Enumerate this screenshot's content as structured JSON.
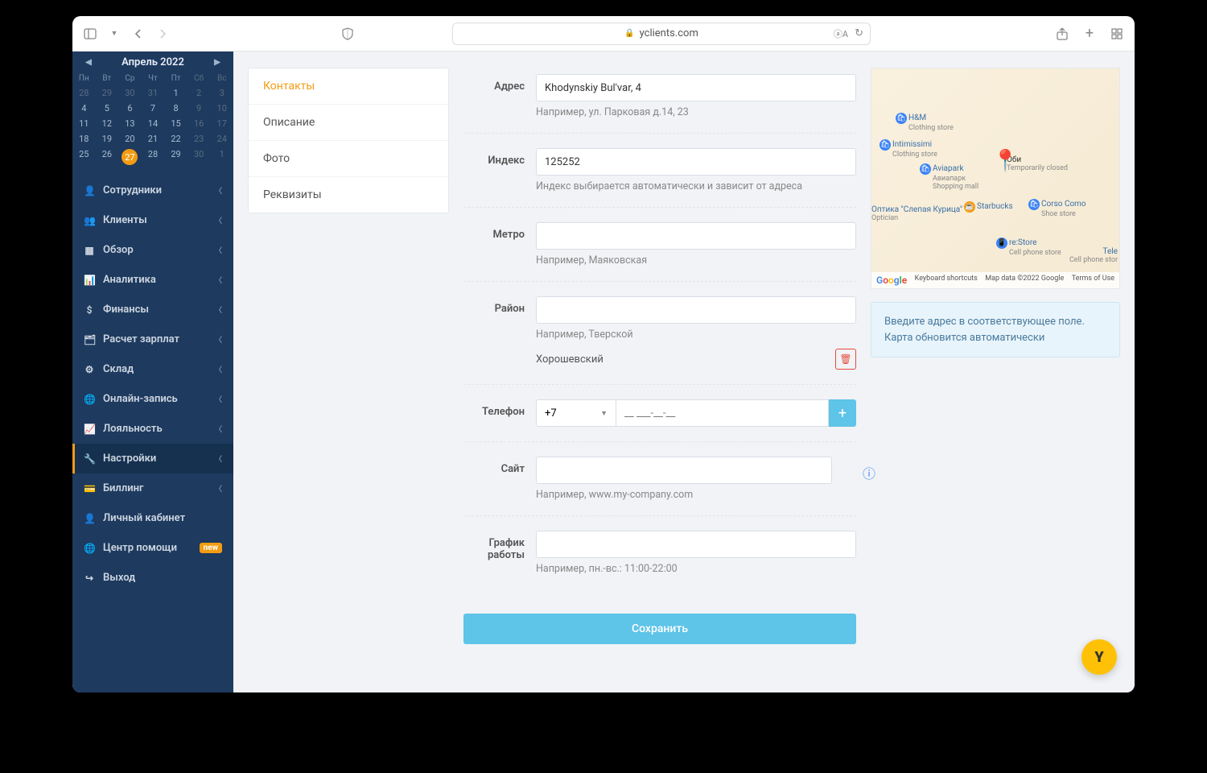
{
  "browser": {
    "url": "yclients.com"
  },
  "calendar": {
    "title": "Апрель 2022",
    "dow": [
      "Пн",
      "Вт",
      "Ср",
      "Чт",
      "Пт",
      "Сб",
      "Вс"
    ],
    "today": "27"
  },
  "nav": {
    "items": [
      {
        "label": "Сотрудники",
        "icon": "user"
      },
      {
        "label": "Клиенты",
        "icon": "users"
      },
      {
        "label": "Обзор",
        "icon": "grid"
      },
      {
        "label": "Аналитика",
        "icon": "chart"
      },
      {
        "label": "Финансы",
        "icon": "dollar"
      },
      {
        "label": "Расчет зарплат",
        "icon": "card"
      },
      {
        "label": "Склад",
        "icon": "gear"
      },
      {
        "label": "Онлайн-запись",
        "icon": "globe"
      },
      {
        "label": "Лояльность",
        "icon": "trend"
      },
      {
        "label": "Настройки",
        "icon": "wrench",
        "active": true
      },
      {
        "label": "Биллинг",
        "icon": "credit"
      },
      {
        "label": "Личный кабинет",
        "icon": "person"
      },
      {
        "label": "Центр помощи",
        "icon": "globe",
        "badge": "new"
      },
      {
        "label": "Выход",
        "icon": "exit"
      }
    ]
  },
  "tabs": [
    {
      "label": "Контакты",
      "active": true
    },
    {
      "label": "Описание"
    },
    {
      "label": "Фото"
    },
    {
      "label": "Реквизиты"
    }
  ],
  "form": {
    "address": {
      "label": "Адрес",
      "value": "Khodynskiy Bul'var, 4",
      "hint": "Например, ул. Парковая д.14, 23"
    },
    "index": {
      "label": "Индекс",
      "value": "125252",
      "hint": "Индекс выбирается автоматически и зависит от адреса"
    },
    "metro": {
      "label": "Метро",
      "value": "",
      "hint": "Например, Маяковская"
    },
    "district": {
      "label": "Район",
      "value": "",
      "hint": "Например, Тверской",
      "tag": "Хорошевский"
    },
    "phone": {
      "label": "Телефон",
      "prefix": "+7",
      "mask": "__ ___-__-__"
    },
    "site": {
      "label": "Сайт",
      "value": "",
      "hint": "Например, www.my-company.com"
    },
    "schedule": {
      "label": "График работы",
      "value": "",
      "hint": "Например, пн.-вс.: 11:00-22:00"
    },
    "save": "Сохранить"
  },
  "map": {
    "hint": "Введите адрес в соответствующее поле. Карта обновится автоматически",
    "footer": {
      "kb": "Keyboard shortcuts",
      "data": "Map data ©2022 Google",
      "terms": "Terms of Use"
    },
    "pois": {
      "obi": "Оби",
      "obi_sub": "Temporarily closed",
      "hm": "H&M",
      "hm_sub": "Clothing store",
      "inti": "Intimissimi",
      "inti_sub": "Clothing store",
      "avia": "Aviapark",
      "avia_ru": "Авиапарк",
      "avia_sub": "Shopping mall",
      "optic": "Оптика \"Слепая Курица\"",
      "optic_sub": "Optician",
      "sb": "Starbucks",
      "corso": "Corso Como",
      "corso_sub": "Shoe store",
      "restore": "re:Store",
      "restore_sub": "Cell phone store",
      "tele": "Tele",
      "tele_sub": "Cell phone stor"
    }
  }
}
